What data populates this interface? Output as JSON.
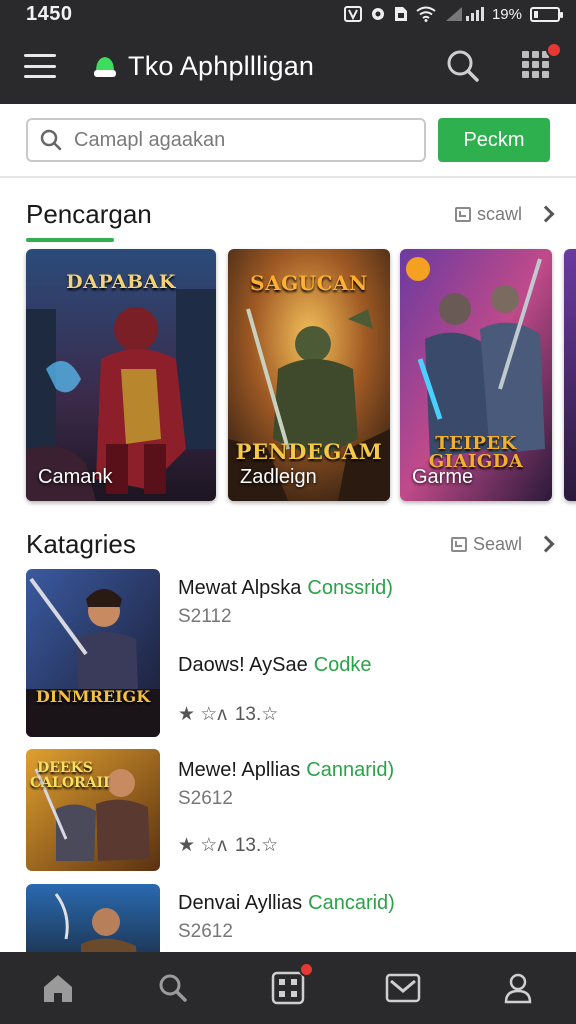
{
  "status_bar": {
    "time": "1450",
    "battery": "19%",
    "battery_level": 0.19
  },
  "app_bar": {
    "title": "Tko Aphpllligan",
    "notification_badge": true
  },
  "search": {
    "placeholder": "Camapl agaakan",
    "button_label": "Peckm"
  },
  "featured": {
    "title": "Pencargan",
    "see_all_label": "scawl",
    "cards": [
      {
        "label": "Camank",
        "art_text": "DAPABAK"
      },
      {
        "label": "Zadleign",
        "art_text": "SAGUCAN",
        "art_text_2": "PENDEGAM"
      },
      {
        "label": "Garme",
        "art_text": "TEIPEK GIAIGDA"
      }
    ]
  },
  "categories": {
    "title": "Katagries",
    "see_all_label": "Seawl",
    "items": [
      {
        "name": "Mewat Alpska",
        "tag": "Conssrid)",
        "code": "S2112",
        "name2": "Daows! AySae",
        "tag2": "Codke",
        "rating_stars": "★  ☆ʌ",
        "rating": "13.☆",
        "art_text": "DINMREIGK"
      },
      {
        "name": "Mewe! Apllias",
        "tag": "Cannarid)",
        "code": "S2612",
        "rating_stars": "★  ☆ʌ",
        "rating": "13.☆",
        "art_text": "DEEKS CALORAII"
      },
      {
        "name": "Denvai Ayllias",
        "tag": "Cancarid)",
        "code": "S2612"
      }
    ]
  },
  "colors": {
    "accent": "#2db04d",
    "bar": "#2a2a2c",
    "badge": "#e53935"
  },
  "bottom_nav": [
    "home-icon",
    "search-icon",
    "apps-icon",
    "inbox-icon",
    "profile-icon"
  ]
}
